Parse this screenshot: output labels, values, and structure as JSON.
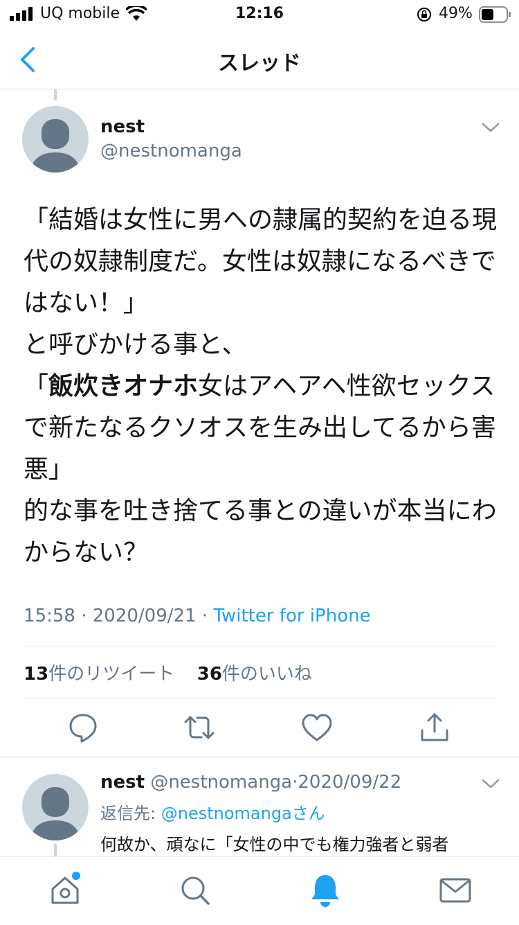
{
  "status_bar": {
    "carrier": "UQ mobile",
    "time": "12:16",
    "battery_percent": "49%"
  },
  "nav": {
    "title": "スレッド",
    "back_icon": "chevron-left-icon"
  },
  "tweet": {
    "name": "nest",
    "handle": "@nestnomanga",
    "text_part1": "「結婚は女性に男への隷属的契約を迫る現代の奴隷制度だ。女性は奴隷になるべきではない！」\nと呼びかける事と、\n「",
    "text_bold": "飯炊きオナホ",
    "text_part2": "女はアヘアヘ性欲セックスで新たなるクソオスを生み出してるから害悪」\n的な事を吐き捨てる事との違いが本当にわからない？",
    "time": "15:58",
    "date": "2020/09/21",
    "dot": "·",
    "source": "Twitter for iPhone",
    "retweet_count": "13",
    "retweet_label": "件のリツイート",
    "like_count": "36",
    "like_label": "件のいいね"
  },
  "actions": [
    "reply-icon",
    "retweet-icon",
    "like-icon",
    "share-icon"
  ],
  "reply": {
    "name": "nest",
    "handle": "@nestnomanga",
    "dot": "·",
    "date": "2020/09/22",
    "reply_to_label": "返信先:",
    "reply_to_handle": "@nestnomangaさん",
    "text": "何故か、頑なに「女性の中でも権力強者と弱者"
  },
  "tabs": [
    "home-icon",
    "search-icon",
    "notifications-icon",
    "messages-icon"
  ],
  "colors": {
    "accent": "#1da1f2",
    "text": "#14171a",
    "secondary": "#657786",
    "avatar_bg": "#ccd6dd"
  }
}
